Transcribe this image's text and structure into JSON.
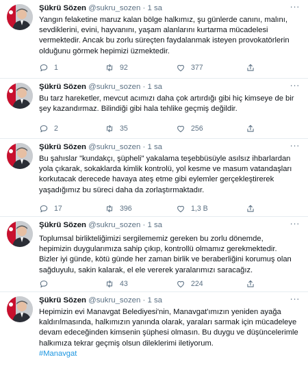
{
  "tweets": [
    {
      "name": "Şükrü Sözen",
      "handle": "@sukru_sozen",
      "separator": "·",
      "time": "1 sa",
      "lines": [
        "Yangın felaketine maruz kalan bölge halkımız, şu günlerde canını, malını,",
        "sevdiklerini, evini, hayvanını, yaşam alanlarını kurtarma mücadelesi",
        "vermektedir. Ancak bu zorlu süreçten faydalanmak isteyen provokatörlerin",
        "olduğunu görmek hepimizi üzmektedir."
      ],
      "hashtag": "",
      "replies": "1",
      "retweets": "92",
      "likes": "377"
    },
    {
      "name": "Şükrü Sözen",
      "handle": "@sukru_sozen",
      "separator": "·",
      "time": "1 sa",
      "lines": [
        "Bu tarz hareketler, mevcut acımızı daha çok artırdığı gibi hiç kimseye de bir",
        "şey kazandırmaz. Bilindiği gibi hala tehlike geçmiş değildir."
      ],
      "hashtag": "",
      "replies": "2",
      "retweets": "35",
      "likes": "256"
    },
    {
      "name": "Şükrü Sözen",
      "handle": "@sukru_sozen",
      "separator": "·",
      "time": "1 sa",
      "lines": [
        "Bu şahıslar \"kundakçı, şüpheli\" yakalama teşebbüsüyle asılsız ihbarlardan",
        "yola çıkarak, sokaklarda kimlik kontrolü, yol kesme ve masum vatandaşları",
        "korkutacak derecede havaya ateş etme gibi eylemler gerçekleştirerek",
        "yaşadığımız bu süreci daha da zorlaştırmaktadır."
      ],
      "hashtag": "",
      "replies": "17",
      "retweets": "396",
      "likes": "1,3 B"
    },
    {
      "name": "Şükrü Sözen",
      "handle": "@sukru_sozen",
      "separator": "·",
      "time": "1 sa",
      "lines": [
        "Toplumsal birlikteliğimizi  sergilememiz gereken bu zorlu dönemde,",
        "hepimizin duygularımıza sahip çıkıp, kontrollü olmamız gerekmektedir.",
        "Bizler iyi günde, kötü günde her zaman birlik ve beraberliğini korumuş olan",
        "sağduyulu,  sakin kalarak, el ele vererek yaralarımızı saracağız."
      ],
      "hashtag": "",
      "replies": "",
      "retweets": "43",
      "likes": "224"
    },
    {
      "name": "Şükrü Sözen",
      "handle": "@sukru_sozen",
      "separator": "·",
      "time": "1 sa",
      "lines": [
        "Hepimizin evi Manavgat Belediyesi'nin, Manavgat'ımızın yeniden ayağa",
        "kaldırılmasında, halkımızın yanında olarak, yaraları sarmak için mücadeleye",
        "devam edeceğinden kimsenin şüphesi olmasın. Bu duygu ve düşüncelerimle",
        "halkımıza tekrar geçmiş olsun dileklerimi iletiyorum."
      ],
      "hashtag": "#Manavgat",
      "replies": "",
      "retweets": "",
      "likes": ""
    }
  ]
}
